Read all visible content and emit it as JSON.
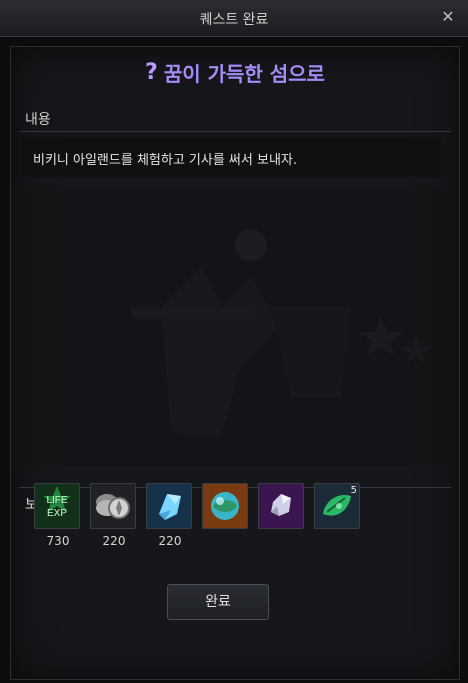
{
  "window": {
    "title": "퀘스트 완료"
  },
  "quest": {
    "name": "꿈이 가득한 섬으로",
    "content_label": "내용",
    "content_text": "비키니 아일랜드를 체험하고 기사를 써서 보내자.",
    "reward_label": "보상"
  },
  "rewards": [
    {
      "icon": "life-exp-icon",
      "text": "LIFE\nEXP",
      "count": "730",
      "color": "#1c4a1e"
    },
    {
      "icon": "coin-icon",
      "count": "220",
      "color": "#2b2c2f"
    },
    {
      "icon": "crystal-icon",
      "count": "220",
      "color": "#1d3550"
    },
    {
      "icon": "orb-icon",
      "count": "",
      "color": "#6b3516"
    },
    {
      "icon": "gem-icon",
      "count": "",
      "color": "#3d1a56"
    },
    {
      "icon": "leaf-stone-icon",
      "badge": "5",
      "count": "",
      "color": "#1d2f3f"
    }
  ],
  "buttons": {
    "complete": "완료"
  }
}
